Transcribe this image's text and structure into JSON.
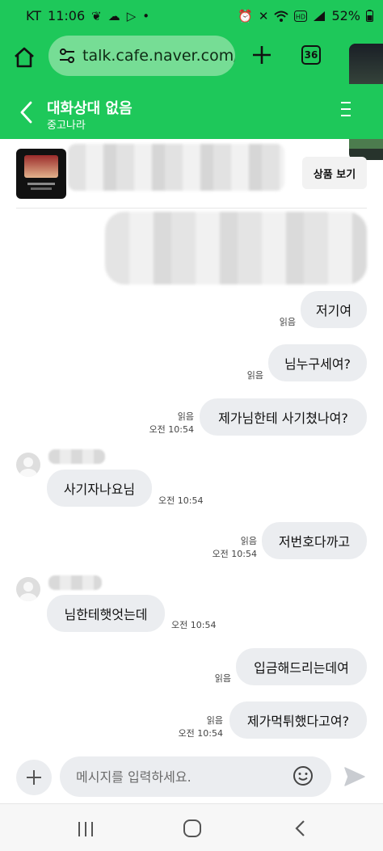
{
  "status_bar": {
    "carrier": "KT",
    "time": "11:06",
    "battery": "52%"
  },
  "browser": {
    "url": "talk.cafe.naver.com/",
    "tab_count": "36"
  },
  "chat": {
    "title": "대화상대 없음",
    "subtitle": "중고나라"
  },
  "product": {
    "view_button": "상품 보기"
  },
  "messages": [
    {
      "side": "out",
      "text": "저기여",
      "read": "읽음",
      "time": ""
    },
    {
      "side": "out",
      "text": "님누구세여?",
      "read": "읽음",
      "time": ""
    },
    {
      "side": "out",
      "text": "제가님한테 사기쳤나여?",
      "read": "읽음",
      "time": "오전 10:54"
    },
    {
      "side": "in",
      "text": "사기자나요님",
      "time": "오전 10:54"
    },
    {
      "side": "out",
      "text": "저번호다까고",
      "read": "읽음",
      "time": "오전 10:54"
    },
    {
      "side": "in",
      "text": "님한테햇엇는데",
      "time": "오전 10:54"
    },
    {
      "side": "out",
      "text": "입금해드리는데여",
      "read": "읽음",
      "time": ""
    },
    {
      "side": "out",
      "text": "제가먹튀했다고여?",
      "read": "읽음",
      "time": "오전 10:54"
    }
  ],
  "composer": {
    "placeholder": "메시지를 입력하세요."
  },
  "colors": {
    "brand_green": "#1ec85a",
    "bubble_gray": "#ebedf0"
  }
}
